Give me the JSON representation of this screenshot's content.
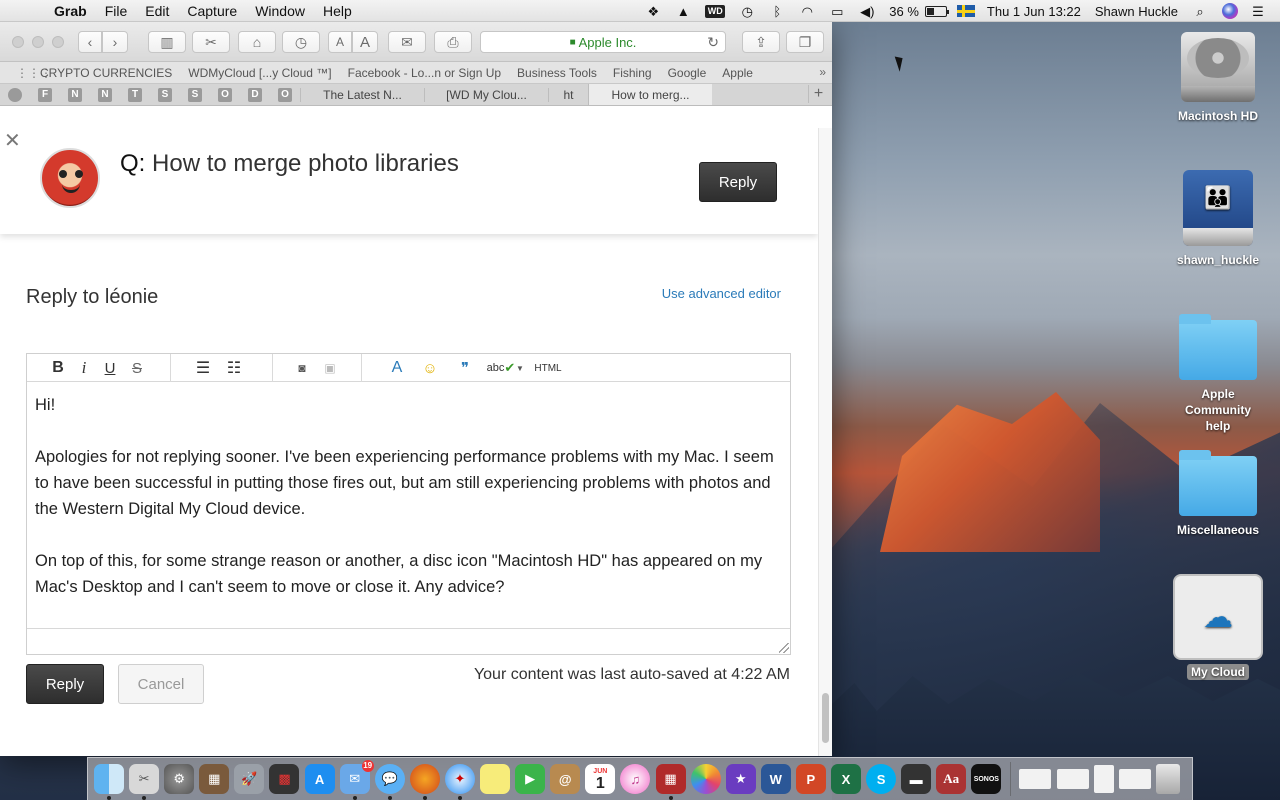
{
  "menubar": {
    "app_name": "Grab",
    "menus": [
      "File",
      "Edit",
      "Capture",
      "Window",
      "Help"
    ],
    "battery": "36 %",
    "datetime": "Thu 1 Jun  13:22",
    "user": "Shawn Huckle",
    "tray_icons": [
      "dropbox-icon",
      "google-drive-icon",
      "wd-icon",
      "time-machine-icon",
      "bluetooth-icon",
      "wifi-icon",
      "airplay-icon",
      "volume-icon"
    ]
  },
  "browser": {
    "address": "Apple Inc.",
    "bookmarks": [
      "CRYPTO CURRENCIES",
      "WDMyCloud [...y Cloud ™]",
      "Facebook - Lo...n or Sign Up",
      "Business Tools",
      "Fishing",
      "Google",
      "Apple"
    ],
    "pinned_tabs": [
      "F",
      "N",
      "N",
      "T",
      "S",
      "S",
      "O",
      "D",
      "O"
    ],
    "tabs": [
      {
        "label": "The Latest N...",
        "active": false
      },
      {
        "label": "[WD My Clou...",
        "active": false
      },
      {
        "label": "ht",
        "active": false
      },
      {
        "label": "How to merg...",
        "active": true
      }
    ]
  },
  "page": {
    "question_prefix": "Q:",
    "question_title": "How to merge photo libraries",
    "header_reply_label": "Reply",
    "reply_heading": "Reply to léonie",
    "advanced_editor_link": "Use advanced editor",
    "editor_toolbar": {
      "bold": "B",
      "italic": "i",
      "underline": "U",
      "strike": "S",
      "spellcheck": "abc",
      "html": "HTML"
    },
    "editor_paragraphs": [
      "Hi!",
      "",
      "Apologies for not replying sooner. I've been experiencing performance problems with my Mac. I seem to have been successful in putting those fires out, but am still experiencing problems with photos and the Western Digital My Cloud device.",
      "",
      "On top of this, for some strange reason or another, a disc icon \"Macintosh HD\" has appeared on my Mac's Desktop and I can't seem to move or close it. Any advice?"
    ],
    "reply_button": "Reply",
    "cancel_button": "Cancel",
    "autosave_text": "Your content was last auto-saved at 4:22 AM"
  },
  "desktop_icons": [
    {
      "label": "Macintosh HD",
      "type": "hard-drive"
    },
    {
      "label": "shawn_huckle",
      "type": "network-drive"
    },
    {
      "label": "Apple Community help",
      "type": "folder"
    },
    {
      "label": "Miscellaneous",
      "type": "folder"
    },
    {
      "label": "My Cloud",
      "type": "alias"
    }
  ],
  "dock": {
    "calendar_month": "JUN",
    "calendar_day": "1",
    "mail_badge": "19",
    "sonos_label": "SONOS",
    "items": [
      "finder",
      "grab",
      "system-preferences",
      "calculator",
      "launchpad",
      "photo-booth",
      "app-store",
      "mail",
      "messages",
      "firefox",
      "safari",
      "stickies",
      "facetime",
      "contacts",
      "calendar",
      "itunes",
      "photo-booth-2",
      "photos",
      "imovie",
      "word",
      "powerpoint",
      "excel",
      "skype",
      "wd-sync",
      "dictionary",
      "sonos"
    ]
  },
  "colors": {
    "link": "#2b7bb9",
    "address_lock": "#2c8a2c",
    "dark_button": "#333333"
  }
}
